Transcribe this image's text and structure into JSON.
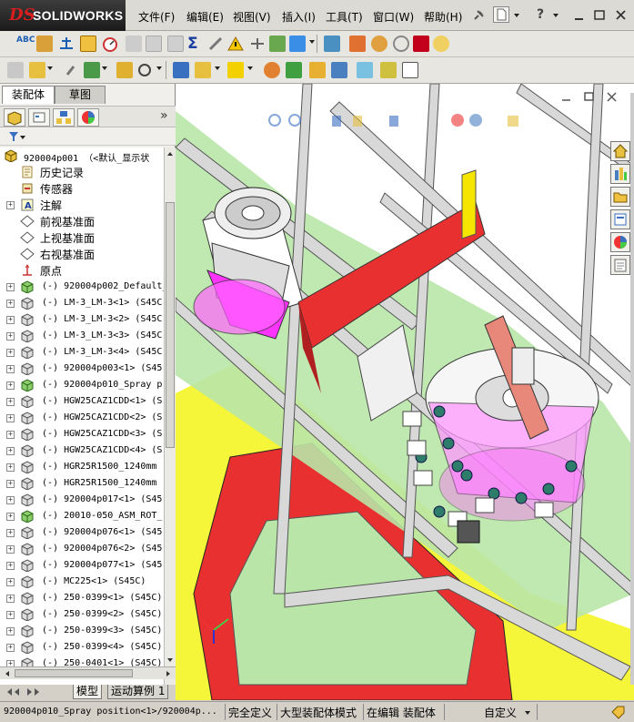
{
  "app": {
    "logo_ds": "DS",
    "logo_name": "SOLIDWORKS"
  },
  "menu": [
    "文件(F)",
    "编辑(E)",
    "视图(V)",
    "插入(I)",
    "工具(T)",
    "窗口(W)",
    "帮助(H)"
  ],
  "panel_tabs": {
    "assembly": "装配体",
    "sketch": "草图"
  },
  "tree": {
    "root": "920004p001 （<默认_显示状",
    "features": [
      "历史记录",
      "传感器",
      "注解",
      "前视基准面",
      "上视基准面",
      "右视基准面",
      "原点"
    ],
    "components": [
      "(-) 920004p002_Default_",
      "(-) LM-3_LM-3<1> (S45C",
      "(-) LM-3_LM-3<2> (S45C",
      "(-) LM-3_LM-3<3> (S45C",
      "(-) LM-3_LM-3<4> (S45C",
      "(-) 920004p003<1> (S45",
      "(-) 920004p010_Spray p",
      "(-) HGW25CAZ1CDD<1> (S",
      "(-) HGW25CAZ1CDD<2> (S",
      "(-) HGW25CAZ1CDD<3> (S",
      "(-) HGW25CAZ1CDD<4> (S",
      "(-) HGR25R1500_1240mm",
      "(-) HGR25R1500_1240mm",
      "(-) 920004p017<1> (S45",
      "(-) 20010-050_ASM_ROT_",
      "(-) 920004p076<1> (S45",
      "(-) 920004p076<2> (S45",
      "(-) 920004p077<1> (S45",
      "(-) MC225<1> (S45C)",
      "(-) 250-0399<1> (S45C)",
      "(-) 250-0399<2> (S45C)",
      "(-) 250-0399<3> (S45C)",
      "(-) 250-0399<4> (S45C)",
      "(-) 250-0401<1> (S45C)"
    ]
  },
  "bottom_tabs": {
    "model": "模型",
    "motion": "运动算例 1"
  },
  "status": {
    "selection": "920004p010_Spray position<1>/920004p...",
    "fully_defined": "完全定义",
    "large_assembly": "大型装配体模式",
    "editing": "在编辑 装配体",
    "custom": "自定义"
  },
  "colors": {
    "accent": "#1a5fb4",
    "frame_green": "#b9e6a8",
    "floor_yellow": "#f5f53a",
    "red_part": "#e83030",
    "magenta_part": "#ff33ff",
    "salmon_part": "#e8887a"
  }
}
